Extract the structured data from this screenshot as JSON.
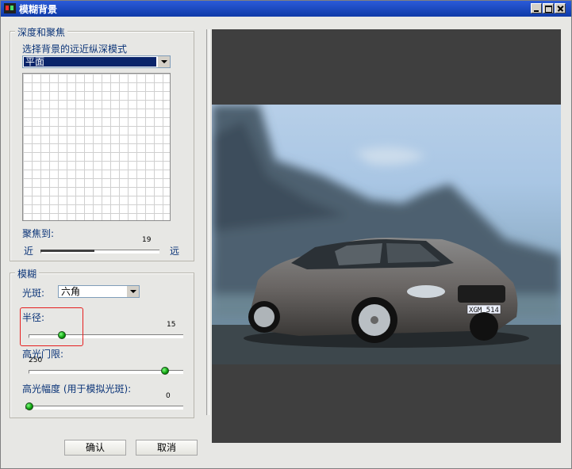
{
  "window": {
    "title": "模糊背景"
  },
  "depth_focus": {
    "group_label": "深度和聚焦",
    "mode_label": "选择背景的远近纵深模式",
    "mode_value": "平面",
    "focus_label": "聚焦到:",
    "near_label": "近",
    "far_label": "远",
    "focus_value": "19",
    "focus_fraction": 0.45
  },
  "blur": {
    "group_label": "模糊",
    "bokeh_label": "光斑:",
    "bokeh_value": "六角",
    "radius_label": "半径:",
    "radius_value": "15",
    "radius_fraction": 0.2,
    "threshold_label": "高光门限:",
    "threshold_value": "250",
    "threshold_fraction": 0.9,
    "amplitude_label": "高光幅度 (用于模拟光斑):",
    "amplitude_value": "0",
    "amplitude_fraction": 0.0
  },
  "buttons": {
    "ok": "确认",
    "cancel": "取消"
  },
  "preview": {
    "plate_text": "XGM 514"
  },
  "colors": {
    "highlight_box": "#e61e1e",
    "slider_thumb": "#17b217"
  }
}
